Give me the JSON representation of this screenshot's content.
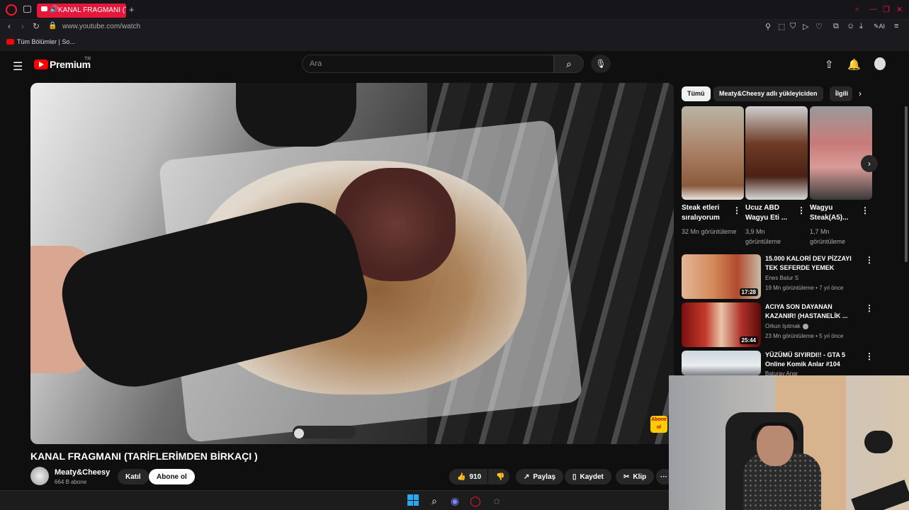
{
  "browser": {
    "tab_title": "KANAL FRAGMANI (TA",
    "new_tab": "+",
    "url": "www.youtube.com/watch",
    "bookmark": "Tüm Bölümler | So...",
    "ai_label": "AI"
  },
  "youtube": {
    "brand": "Premium",
    "region": "TR",
    "search_placeholder": "Ara"
  },
  "video": {
    "title": "KANAL FRAGMANI (TARİFLERİMDEN BİRKAÇI )",
    "overlay_badge": "Abone ol",
    "channel_name": "Meaty&Cheesy",
    "subscribers": "664 B abone",
    "join_label": "Katıl",
    "subscribe_label": "Abone ol",
    "likes": "910",
    "share_label": "Paylaş",
    "save_label": "Kaydet",
    "clip_label": "Klip",
    "more": "···"
  },
  "chips": [
    "Tümü",
    "Meaty&Cheesy adlı yükleyiciden",
    "İlgili"
  ],
  "shorts": [
    {
      "title": "Steak etleri sıralıyorum",
      "views": "32 Mn görüntüleme"
    },
    {
      "title": "Ucuz ABD Wagyu Eti ...",
      "views": "3,9 Mn görüntüleme"
    },
    {
      "title": "Wagyu Steak(A5)...",
      "views": "1,7 Mn görüntüleme"
    }
  ],
  "recommendations": [
    {
      "title": "15.000 KALORİ DEV PİZZAYI TEK SEFERDE YEMEK",
      "channel": "Enes Batur S",
      "meta": "19 Mn görüntüleme • 7 yıl önce",
      "duration": "17:28"
    },
    {
      "title": "ACIYA SON DAYANAN KAZANIR! (HASTANELİK ...",
      "channel": "Orkun Işıtmak",
      "meta": "23 Mn görüntüleme • 5 yıl önce",
      "duration": "25:44"
    },
    {
      "title": "YÜZÜMÜ SIYIRDI!! - GTA 5 Online Komik Anlar #104",
      "channel": "Baturay Anar",
      "meta": "",
      "duration": ""
    }
  ],
  "colors": {
    "accent": "#e5173b",
    "yt_red": "#ff0000",
    "background": "#0f0f0f"
  }
}
